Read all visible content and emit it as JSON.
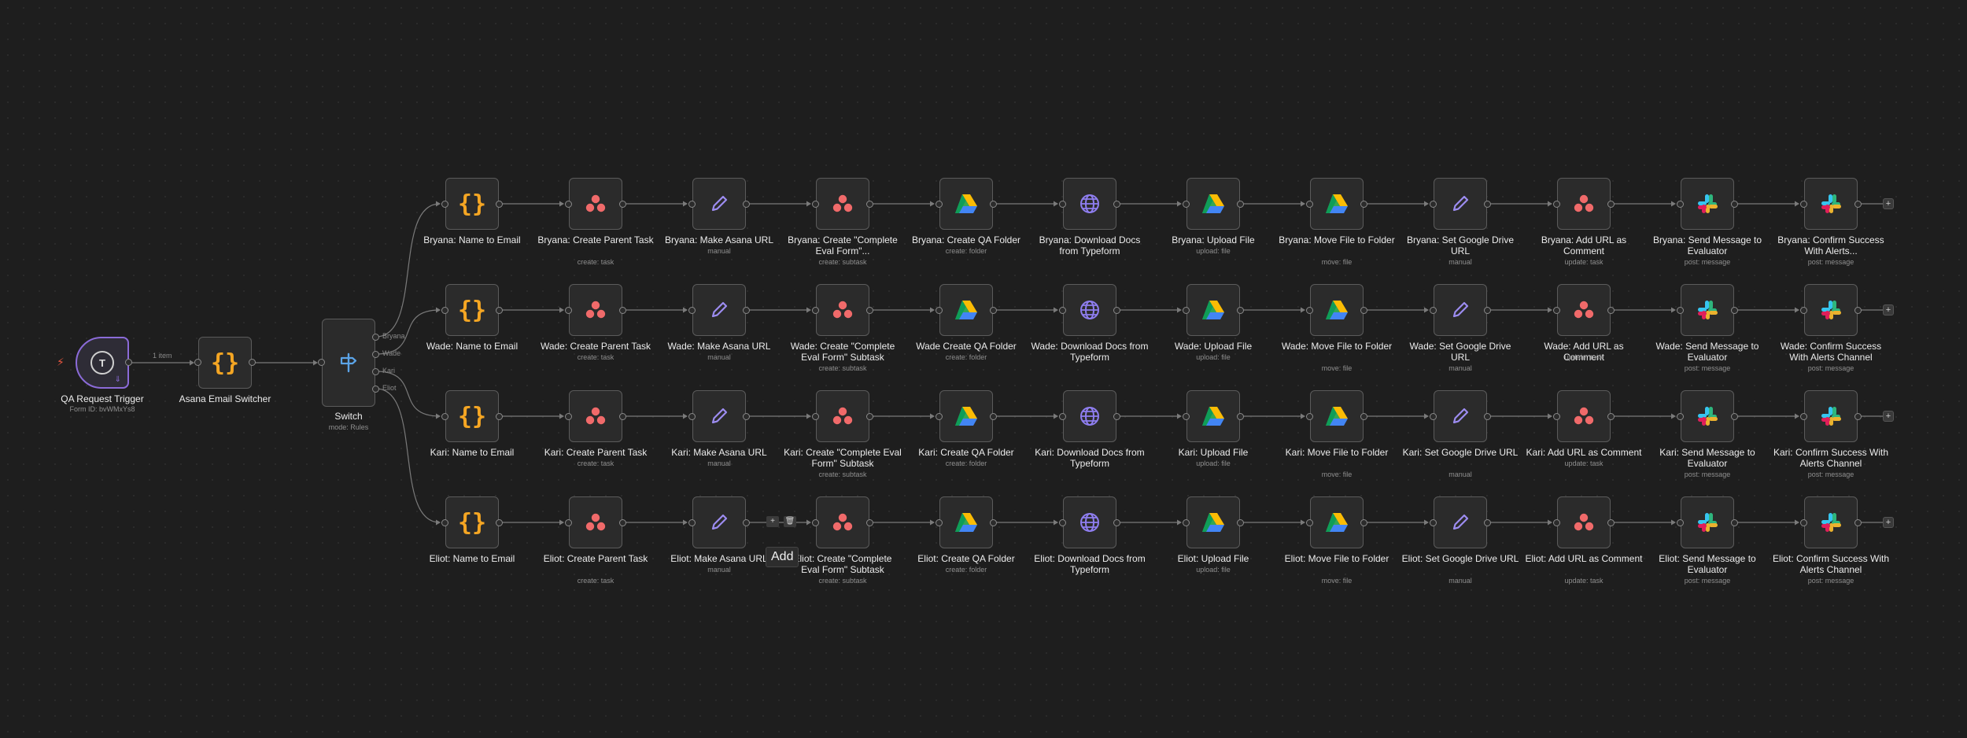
{
  "trigger": {
    "name": "QA Request Trigger",
    "subtitle": "Form ID: bvWMxYs8",
    "letter": "T",
    "icon": "form-trigger-icon",
    "edge_label": "1 item"
  },
  "email_switcher": {
    "name": "Asana Email Switcher",
    "icon": "code-braces-icon"
  },
  "switch": {
    "name": "Switch",
    "subtitle": "mode: Rules",
    "icon": "signpost-icon",
    "outputs": [
      "Bryana",
      "Wade",
      "Kari",
      "Eliot"
    ]
  },
  "rows": [
    {
      "person": "Bryana",
      "nodes": [
        {
          "label": "Bryana: Name to Email",
          "sub": "",
          "icon": "code"
        },
        {
          "label": "Bryana: Create Parent Task",
          "sub": "create: task",
          "icon": "asana"
        },
        {
          "label": "Bryana: Make Asana URL",
          "sub": "manual",
          "icon": "edit"
        },
        {
          "label": "Bryana: Create \"Complete Eval Form\"...",
          "sub": "create: subtask",
          "icon": "asana"
        },
        {
          "label": "Bryana: Create QA Folder",
          "sub": "create: folder",
          "icon": "drive"
        },
        {
          "label": "Bryana: Download Docs from Typeform",
          "sub": "",
          "icon": "globe"
        },
        {
          "label": "Bryana: Upload File",
          "sub": "upload: file",
          "icon": "drive"
        },
        {
          "label": "Bryana: Move File to Folder",
          "sub": "move: file",
          "icon": "drive"
        },
        {
          "label": "Bryana: Set Google Drive URL",
          "sub": "manual",
          "icon": "edit"
        },
        {
          "label": "Bryana: Add URL as Comment",
          "sub": "update: task",
          "icon": "asana"
        },
        {
          "label": "Bryana: Send Message to Evaluator",
          "sub": "post: message",
          "icon": "slack"
        },
        {
          "label": "Bryana: Confirm Success With Alerts...",
          "sub": "post: message",
          "icon": "slack"
        }
      ]
    },
    {
      "person": "Wade",
      "nodes": [
        {
          "label": "Wade: Name to Email",
          "sub": "",
          "icon": "code"
        },
        {
          "label": "Wade: Create Parent Task",
          "sub": "create: task",
          "icon": "asana"
        },
        {
          "label": "Wade: Make Asana URL",
          "sub": "manual",
          "icon": "edit"
        },
        {
          "label": "Wade: Create \"Complete Eval Form\" Subtask",
          "sub": "create: subtask",
          "icon": "asana"
        },
        {
          "label": "Wade Create QA Folder",
          "sub": "create: folder",
          "icon": "drive"
        },
        {
          "label": "Wade: Download Docs from Typeform",
          "sub": "",
          "icon": "globe"
        },
        {
          "label": "Wade: Upload File",
          "sub": "upload: file",
          "icon": "drive"
        },
        {
          "label": "Wade: Move File to Folder",
          "sub": "move: file",
          "icon": "drive"
        },
        {
          "label": "Wade: Set Google Drive URL",
          "sub": "manual",
          "icon": "edit"
        },
        {
          "label": "Wade: Add URL as Comment",
          "sub": "update: task",
          "icon": "asana"
        },
        {
          "label": "Wade: Send Message to Evaluator",
          "sub": "post: message",
          "icon": "slack"
        },
        {
          "label": "Wade: Confirm Success With Alerts Channel",
          "sub": "post: message",
          "icon": "slack"
        }
      ]
    },
    {
      "person": "Kari",
      "nodes": [
        {
          "label": "Kari: Name to Email",
          "sub": "",
          "icon": "code"
        },
        {
          "label": "Kari: Create Parent Task",
          "sub": "create: task",
          "icon": "asana"
        },
        {
          "label": "Kari: Make Asana URL",
          "sub": "manual",
          "icon": "edit"
        },
        {
          "label": "Kari: Create \"Complete Eval Form\" Subtask",
          "sub": "create: subtask",
          "icon": "asana"
        },
        {
          "label": "Kari: Create QA Folder",
          "sub": "create: folder",
          "icon": "drive"
        },
        {
          "label": "Kari: Download Docs from Typeform",
          "sub": "",
          "icon": "globe"
        },
        {
          "label": "Kari: Upload File",
          "sub": "upload: file",
          "icon": "drive"
        },
        {
          "label": "Kari: Move File to Folder",
          "sub": "move: file",
          "icon": "drive"
        },
        {
          "label": "Kari: Set Google Drive URL",
          "sub": "manual",
          "icon": "edit"
        },
        {
          "label": "Kari: Add URL as Comment",
          "sub": "update: task",
          "icon": "asana"
        },
        {
          "label": "Kari: Send Message to Evaluator",
          "sub": "post: message",
          "icon": "slack"
        },
        {
          "label": "Kari: Confirm Success With Alerts Channel",
          "sub": "post: message",
          "icon": "slack"
        }
      ]
    },
    {
      "person": "Eliot",
      "nodes": [
        {
          "label": "Eliot: Name to Email",
          "sub": "",
          "icon": "code"
        },
        {
          "label": "Eliot: Create Parent Task",
          "sub": "create: task",
          "icon": "asana"
        },
        {
          "label": "Eliot: Make Asana URL",
          "sub": "manual",
          "icon": "edit"
        },
        {
          "label": "Eliot: Create \"Complete Eval Form\" Subtask",
          "sub": "create: subtask",
          "icon": "asana"
        },
        {
          "label": "Eliot: Create QA Folder",
          "sub": "create: folder",
          "icon": "drive"
        },
        {
          "label": "Eliot: Download Docs from Typeform",
          "sub": "",
          "icon": "globe"
        },
        {
          "label": "Eliot: Upload File",
          "sub": "upload: file",
          "icon": "drive"
        },
        {
          "label": "Eliot: Move File to Folder",
          "sub": "move: file",
          "icon": "drive"
        },
        {
          "label": "Eliot: Set Google Drive URL",
          "sub": "manual",
          "icon": "edit"
        },
        {
          "label": "Eliot: Add URL as Comment",
          "sub": "update: task",
          "icon": "asana"
        },
        {
          "label": "Eliot: Send Message to Evaluator",
          "sub": "post: message",
          "icon": "slack"
        },
        {
          "label": "Eliot: Confirm Success With Alerts Channel",
          "sub": "post: message",
          "icon": "slack"
        }
      ]
    }
  ],
  "edge_hover": {
    "tooltip": "Add",
    "add_icon": "plus-icon",
    "delete_icon": "trash-icon"
  },
  "add_node_symbol": "+",
  "colors": {
    "background": "#1e1e1e",
    "node_bg": "#2b2b2b",
    "node_border": "#5b5b5b",
    "wire": "#7a7a7a",
    "trigger_border": "#8b6bd8",
    "code_orange": "#f5a623",
    "asana_coral": "#f06a6a",
    "edit_purple": "#9c8cf0",
    "globe_purple": "#8f7ef0",
    "switch_blue": "#5ba4e8"
  }
}
